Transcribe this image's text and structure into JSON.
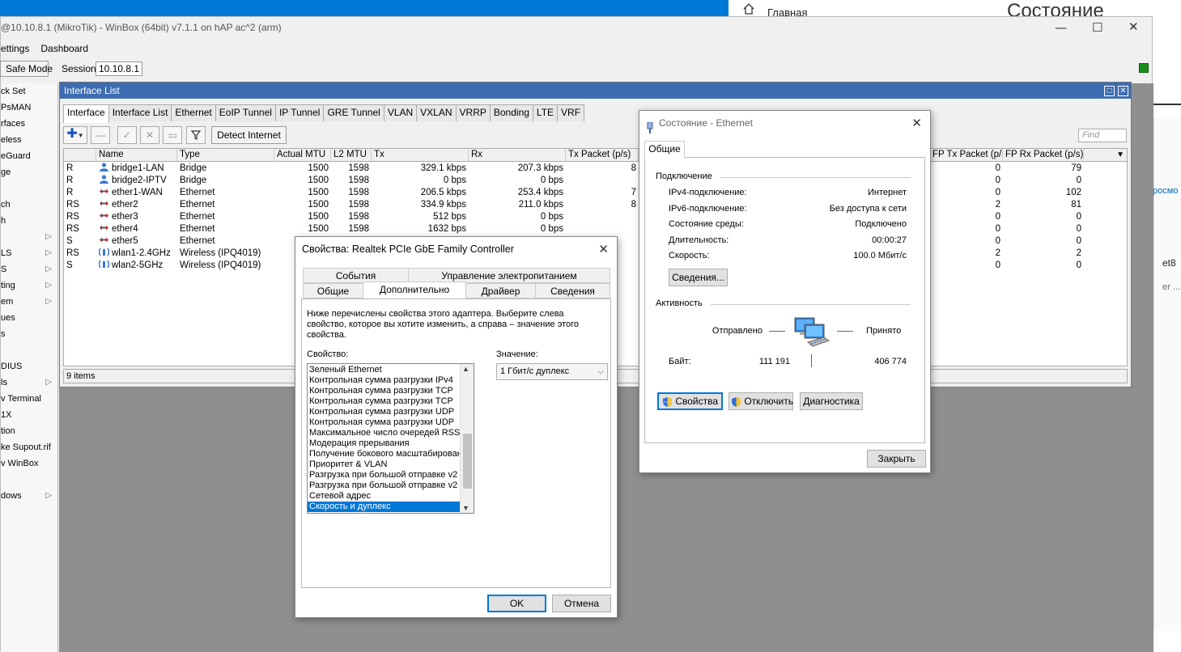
{
  "background": {
    "home_label": "Главная",
    "status_heading": "Состояние",
    "fragments": [
      "росмо",
      "et8",
      "er ..."
    ]
  },
  "winbox": {
    "title": "@10.10.8.1 (MikroTik) - WinBox (64bit) v7.1.1 on hAP ac^2 (arm)",
    "menu": [
      "ettings",
      "Dashboard"
    ],
    "safe_mode_label": "Safe Mode",
    "session_label": "Session:",
    "session_value": "10.10.8.1",
    "sidebar": [
      {
        "label": "ck Set",
        "sub": false
      },
      {
        "label": "PsMAN",
        "sub": false
      },
      {
        "label": "rfaces",
        "sub": false
      },
      {
        "label": "eless",
        "sub": false
      },
      {
        "label": "eGuard",
        "sub": false
      },
      {
        "label": "ge",
        "sub": false
      },
      {
        "label": "",
        "sub": false
      },
      {
        "label": "ch",
        "sub": false
      },
      {
        "label": "h",
        "sub": false
      },
      {
        "label": "",
        "sub": true
      },
      {
        "label": "LS",
        "sub": true
      },
      {
        "label": "S",
        "sub": true
      },
      {
        "label": "ting",
        "sub": true
      },
      {
        "label": "em",
        "sub": true
      },
      {
        "label": "ues",
        "sub": false
      },
      {
        "label": "s",
        "sub": false
      },
      {
        "label": "",
        "sub": false
      },
      {
        "label": "DIUS",
        "sub": false
      },
      {
        "label": "ls",
        "sub": true
      },
      {
        "label": "v Terminal",
        "sub": false
      },
      {
        "label": "1X",
        "sub": false
      },
      {
        "label": "tion",
        "sub": false
      },
      {
        "label": "ke Supout.rif",
        "sub": false
      },
      {
        "label": "v WinBox",
        "sub": false
      },
      {
        "label": "",
        "sub": false
      },
      {
        "label": "dows",
        "sub": true
      }
    ]
  },
  "interface_list": {
    "title": "Interface List",
    "tabs": [
      "Interface",
      "Interface List",
      "Ethernet",
      "EoIP Tunnel",
      "IP Tunnel",
      "GRE Tunnel",
      "VLAN",
      "VXLAN",
      "VRRP",
      "Bonding",
      "LTE",
      "VRF"
    ],
    "detect_label": "Detect Internet",
    "find_placeholder": "Find",
    "columns": {
      "name": "Name",
      "type": "Type",
      "mtu": "Actual MTU",
      "l2mtu": "L2 MTU",
      "tx": "Tx",
      "rx": "Rx",
      "txp": "Tx Packet (p/s)",
      "fptx": "FP Tx Packet (p/s)",
      "fprx": "FP Rx Packet (p/s)"
    },
    "rows": [
      {
        "flag": "R",
        "name": "bridge1-LAN",
        "icon": "bridge",
        "type": "Bridge",
        "mtu": "1500",
        "l2mtu": "1598",
        "tx": "329.1 kbps",
        "rx": "207.3 kbps",
        "txp": "8",
        "fptx": "0",
        "fprx": "79"
      },
      {
        "flag": "R",
        "name": "bridge2-IPTV",
        "icon": "bridge",
        "type": "Bridge",
        "mtu": "1500",
        "l2mtu": "1598",
        "tx": "0 bps",
        "rx": "0 bps",
        "txp": "",
        "fptx": "0",
        "fprx": "0"
      },
      {
        "flag": "R",
        "name": "ether1-WAN",
        "icon": "ether",
        "type": "Ethernet",
        "mtu": "1500",
        "l2mtu": "1598",
        "tx": "206.5 kbps",
        "rx": "253.4 kbps",
        "txp": "7",
        "fptx": "0",
        "fprx": "102"
      },
      {
        "flag": "RS",
        "name": "ether2",
        "icon": "ether",
        "type": "Ethernet",
        "mtu": "1500",
        "l2mtu": "1598",
        "tx": "334.9 kbps",
        "rx": "211.0 kbps",
        "txp": "8",
        "fptx": "2",
        "fprx": "81"
      },
      {
        "flag": "RS",
        "name": "ether3",
        "icon": "ether",
        "type": "Ethernet",
        "mtu": "1500",
        "l2mtu": "1598",
        "tx": "512 bps",
        "rx": "0 bps",
        "txp": "",
        "fptx": "0",
        "fprx": "0"
      },
      {
        "flag": "RS",
        "name": "ether4",
        "icon": "ether",
        "type": "Ethernet",
        "mtu": "1500",
        "l2mtu": "1598",
        "tx": "1632 bps",
        "rx": "0 bps",
        "txp": "",
        "fptx": "0",
        "fprx": "0"
      },
      {
        "flag": "S",
        "name": "ether5",
        "icon": "ether",
        "type": "Ethernet",
        "mtu": "",
        "l2mtu": "",
        "tx": "",
        "rx": "",
        "txp": "",
        "fptx": "0",
        "fprx": "0"
      },
      {
        "flag": "RS",
        "name": "wlan1-2.4GHz",
        "icon": "wlan",
        "type": "Wireless (IPQ4019)",
        "mtu": "",
        "l2mtu": "",
        "tx": "",
        "rx": "",
        "txp": "",
        "fptx": "2",
        "fprx": "2"
      },
      {
        "flag": "S",
        "name": "wlan2-5GHz",
        "icon": "wlan",
        "type": "Wireless (IPQ4019)",
        "mtu": "",
        "l2mtu": "",
        "tx": "",
        "rx": "",
        "txp": "",
        "fptx": "0",
        "fprx": "0"
      }
    ],
    "status": "9 items"
  },
  "eth_status": {
    "title": "Состояние - Ethernet",
    "tab": "Общие",
    "connection_heading": "Подключение",
    "fields": [
      {
        "label": "IPv4-подключение:",
        "value": "Интернет"
      },
      {
        "label": "IPv6-подключение:",
        "value": "Без доступа к сети"
      },
      {
        "label": "Состояние среды:",
        "value": "Подключено"
      },
      {
        "label": "Длительность:",
        "value": "00:00:27"
      },
      {
        "label": "Скорость:",
        "value": "100.0 Мбит/с"
      }
    ],
    "details_button": "Сведения...",
    "activity_heading": "Активность",
    "sent_label": "Отправлено",
    "received_label": "Принято",
    "bytes_label": "Байт:",
    "bytes_sent": "111 191",
    "bytes_received": "406 774",
    "properties_button": "Свойства",
    "disable_button": "Отключить",
    "diagnose_button": "Диагностика",
    "close_button": "Закрыть"
  },
  "props": {
    "title": "Свойства: Realtek PCIe GbE Family Controller",
    "tabs_row1": [
      "События",
      "Управление электропитанием"
    ],
    "tabs_row2": [
      "Общие",
      "Дополнительно",
      "Драйвер",
      "Сведения"
    ],
    "description": "Ниже перечислены свойства этого адаптера. Выберите слева свойство, которое вы хотите изменить, а справа – значение этого свойства.",
    "property_label": "Свойство:",
    "value_label": "Значение:",
    "value_selected": "1 Гбит/с дуплекс",
    "properties": [
      "Зеленый Ethernet",
      "Контрольная сумма разгрузки IPv4",
      "Контрольная сумма разгрузки TCP",
      "Контрольная сумма разгрузки TCP",
      "Контрольная сумма разгрузки UDP",
      "Контрольная сумма разгрузки UDP",
      "Максимальное число очередей RSS",
      "Модерация прерывания",
      "Получение бокового масштабирования",
      "Приоритет & VLAN",
      "Разгрузка при большой отправке v2",
      "Разгрузка при большой отправке v2",
      "Сетевой адрес",
      "Скорость и дуплекс"
    ],
    "selected_index": 13,
    "ok_button": "OK",
    "cancel_button": "Отмена"
  }
}
